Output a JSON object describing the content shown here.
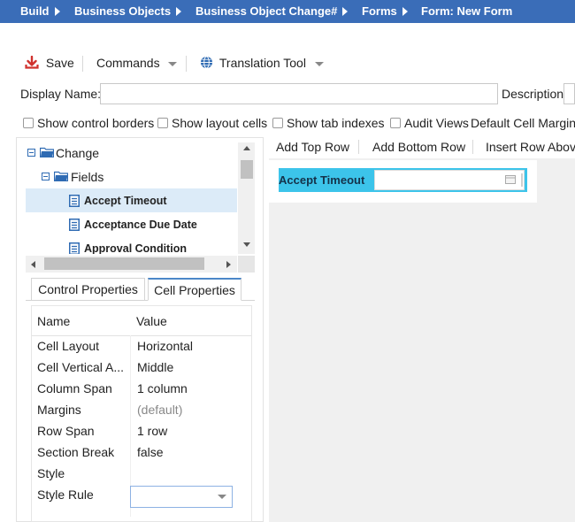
{
  "breadcrumb": {
    "items": [
      "Build",
      "Business Objects",
      "Business Object Change#",
      "Forms",
      "Form: New Form"
    ]
  },
  "toolbar": {
    "save_label": "Save",
    "commands_label": "Commands",
    "translation_label": "Translation Tool"
  },
  "form": {
    "display_name_label": "Display Name:",
    "display_name_value": "",
    "description_label": "Description:",
    "description_value": ""
  },
  "options": {
    "show_control_borders": "Show control borders",
    "show_layout_cells": "Show layout cells",
    "show_tab_indexes": "Show tab indexes",
    "audit_views": "Audit Views",
    "default_cell_margins": "Default Cell Margins"
  },
  "tree": {
    "root": "Change",
    "fields": "Fields",
    "items": [
      "Accept Timeout",
      "Acceptance Due Date",
      "Approval Condition"
    ]
  },
  "tabs": {
    "control_properties": "Control Properties",
    "cell_properties": "Cell Properties"
  },
  "properties": {
    "name_header": "Name",
    "value_header": "Value",
    "rows": [
      {
        "name": "Cell Layout",
        "value": "Horizontal"
      },
      {
        "name": "Cell Vertical A...",
        "value": "Middle"
      },
      {
        "name": "Column Span",
        "value": "1 column"
      },
      {
        "name": "Margins",
        "value": "(default)"
      },
      {
        "name": "Row Span",
        "value": "1 row"
      },
      {
        "name": "Section Break",
        "value": "false"
      },
      {
        "name": "Style",
        "value": ""
      },
      {
        "name": "Style Rule",
        "value": ""
      }
    ]
  },
  "canvas_toolbar": {
    "add_top_row": "Add Top Row",
    "add_bottom_row": "Add Bottom Row",
    "insert_row_above": "Insert Row Above"
  },
  "canvas": {
    "cell_label": "Accept Timeout",
    "cell_value": ""
  },
  "colors": {
    "breadcrumb_bg": "#3a6db8",
    "selected_cell": "#3cc4ea",
    "tree_selected": "#dcebf8",
    "save_icon": "#d0312d"
  }
}
